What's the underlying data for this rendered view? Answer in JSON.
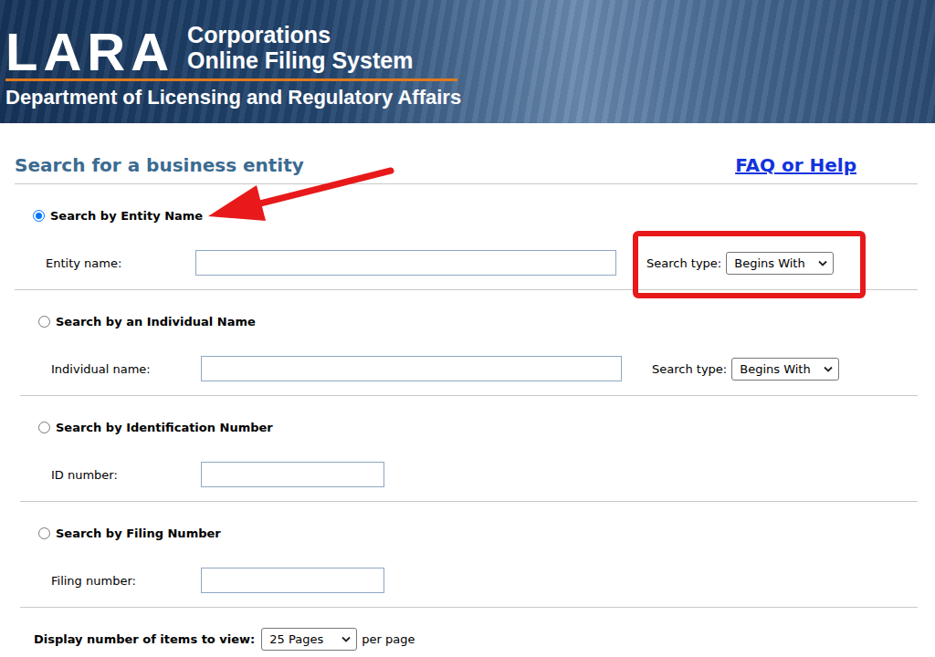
{
  "header": {
    "logo": "LARA",
    "title_lines": [
      "Corporations",
      "Online Filing System"
    ],
    "department": "Department of Licensing and Regulatory Affairs"
  },
  "page_title": "Search for a business entity",
  "help_link": "FAQ or Help",
  "search_options": [
    {
      "label": "Search by Entity Name",
      "selected": true,
      "kind": "typed",
      "field_label": "Entity name:",
      "value": "",
      "type_label": "Search type:",
      "search_type": "Begins With",
      "annotated": true
    },
    {
      "label": "Search by an Individual Name",
      "selected": false,
      "kind": "typed",
      "field_label": "Individual name:",
      "value": "",
      "type_label": "Search type:",
      "search_type": "Begins With",
      "annotated": false
    },
    {
      "label": "Search by Identification Number",
      "selected": false,
      "kind": "short",
      "field_label": "ID number:",
      "value": "",
      "annotated": false
    },
    {
      "label": "Search by Filing Number",
      "selected": false,
      "kind": "short",
      "field_label": "Filing number:",
      "value": "",
      "annotated": false
    }
  ],
  "display": {
    "label": "Display number of items to view:",
    "value": "25 Pages",
    "suffix": "per page"
  }
}
